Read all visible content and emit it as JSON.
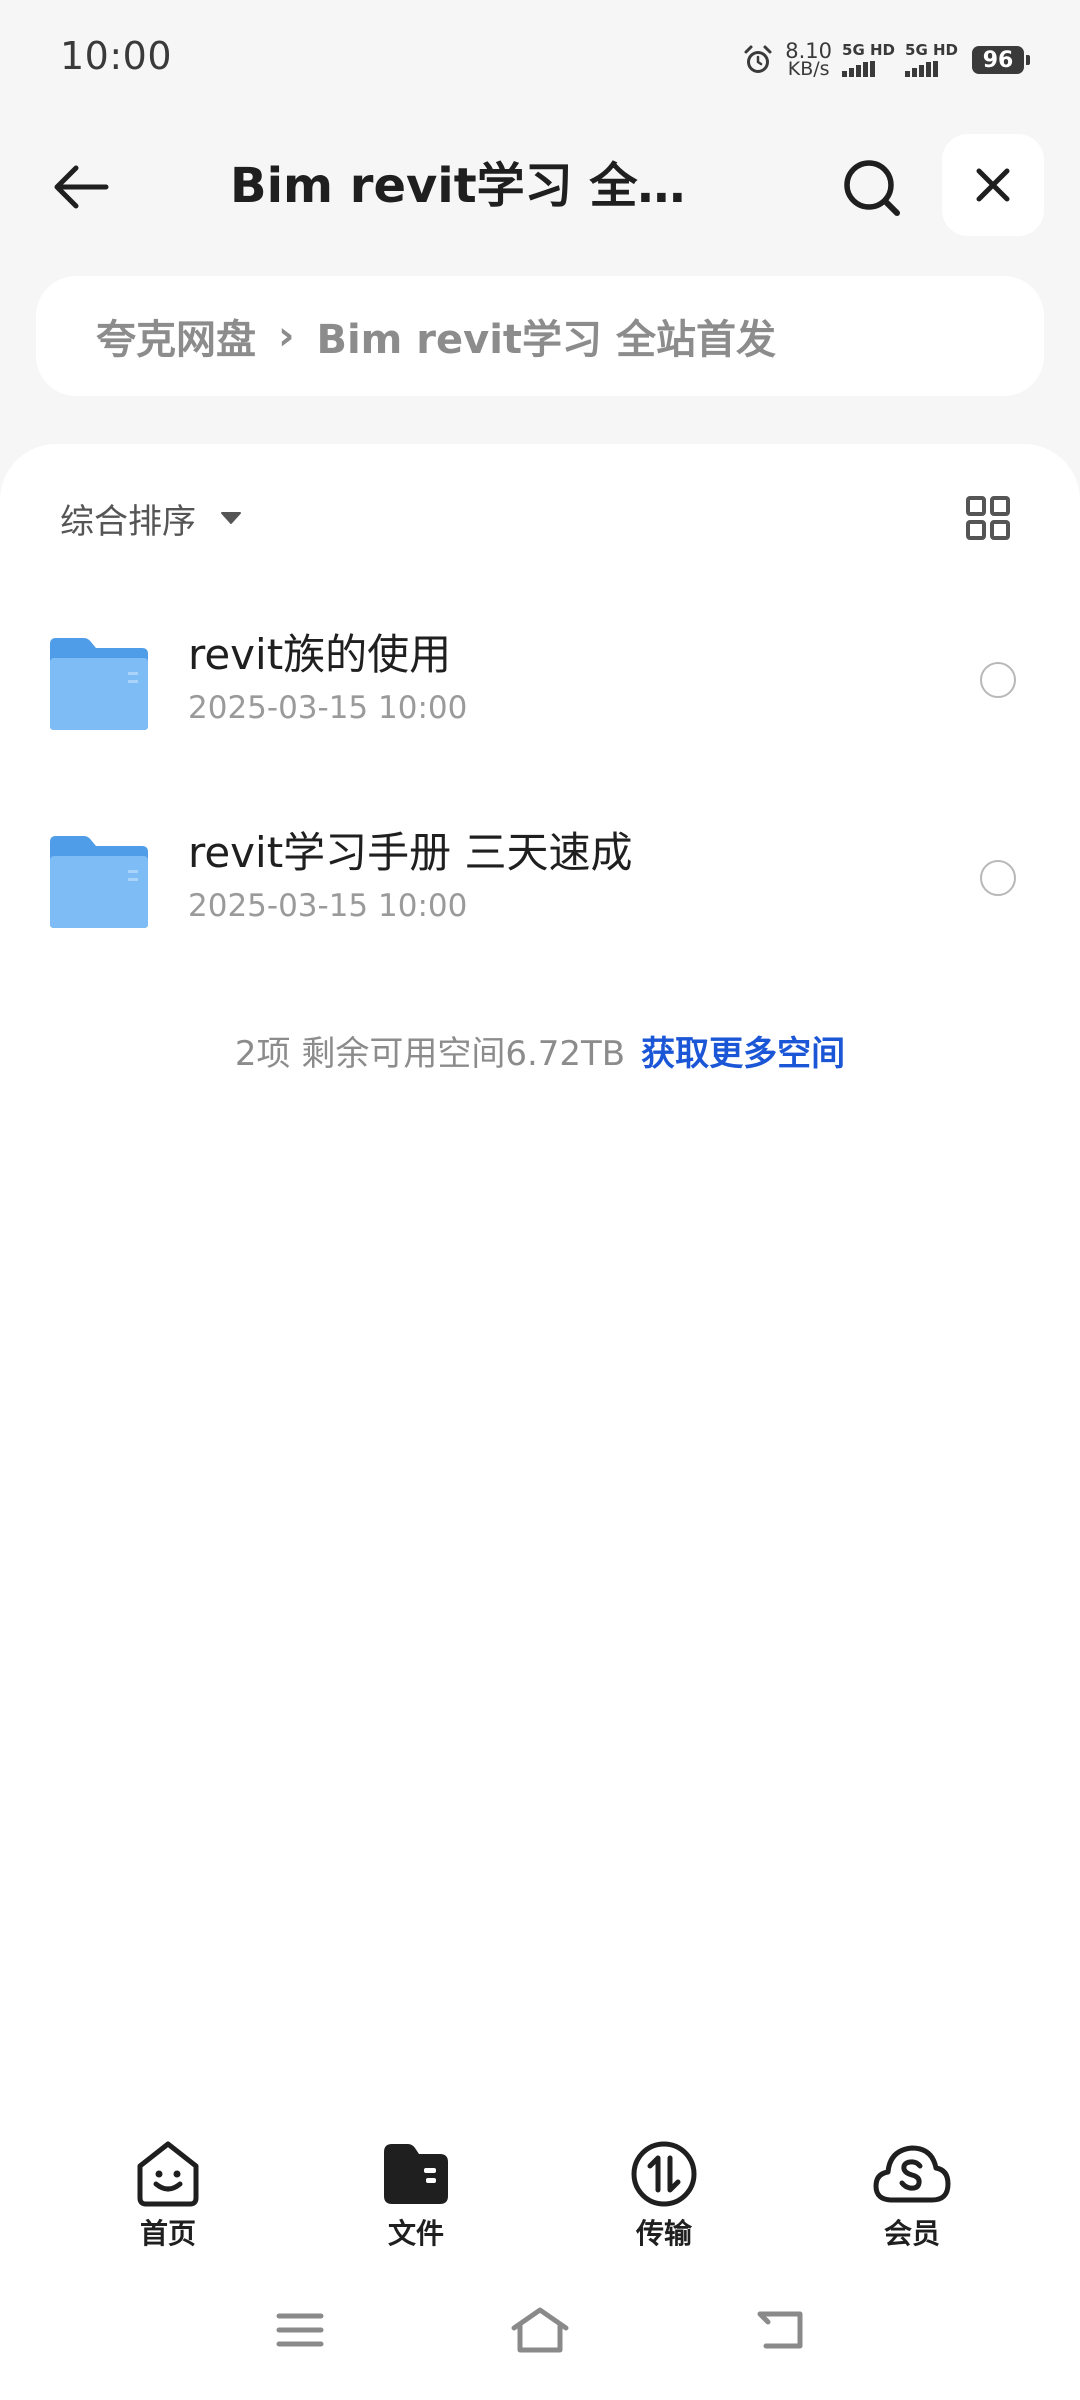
{
  "status_bar": {
    "time": "10:00",
    "net_speed_value": "8.10",
    "net_speed_unit": "KB/s",
    "sim1_label": "5G HD",
    "sim2_label": "5G HD",
    "battery": "96"
  },
  "header": {
    "title": "Bim revit学习 全…"
  },
  "breadcrumb": {
    "root": "夸克网盘",
    "separator": "›",
    "current": "Bim revit学习 全站首发"
  },
  "toolbar": {
    "sort_label": "综合排序"
  },
  "files": [
    {
      "name": "revit族的使用",
      "date": "2025-03-15 10:00"
    },
    {
      "name": "revit学习手册 三天速成",
      "date": "2025-03-15 10:00"
    }
  ],
  "storage": {
    "summary": "2项 剩余可用空间6.72TB",
    "link": "获取更多空间"
  },
  "tabs": [
    {
      "label": "首页",
      "icon": "smile-home-icon"
    },
    {
      "label": "文件",
      "icon": "folder-files-icon"
    },
    {
      "label": "传输",
      "icon": "transfer-icon"
    },
    {
      "label": "会员",
      "icon": "cloud-s-member-icon"
    }
  ],
  "colors": {
    "accent": "#1a56d6",
    "folder": "#62abf0",
    "background": "#f6f6f7"
  }
}
